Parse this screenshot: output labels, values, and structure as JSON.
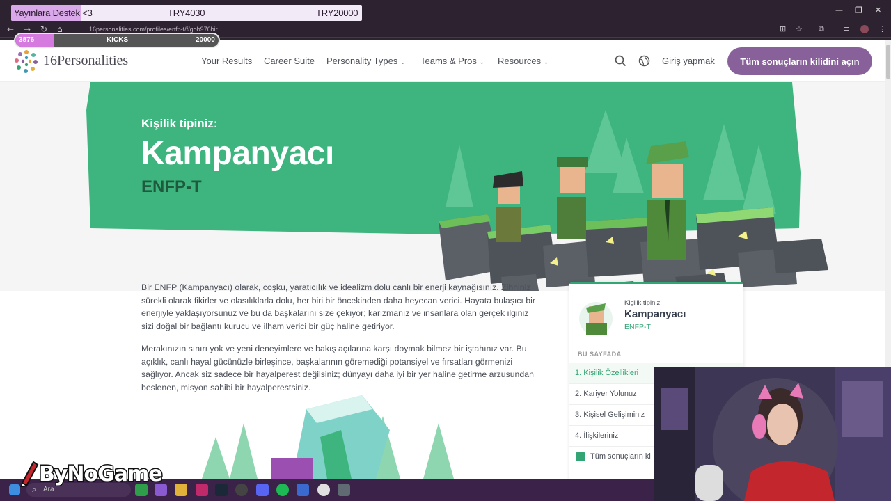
{
  "overlay": {
    "goal_title": "Yayınlara Destek <3",
    "goal_current": "TRY4030",
    "goal_target": "TRY20000",
    "goal_progress": 0.2,
    "kicks_current": "3876",
    "kicks_label": "KICKS",
    "kicks_target": "20000",
    "kicks_progress": 0.19,
    "watermark": "ByNoGame"
  },
  "browser": {
    "url": "16personalities.com/profiles/enfp-t/f/gob976bir"
  },
  "site": {
    "logo_text": "16Personalities",
    "nav": [
      "Your Results",
      "Career Suite",
      "Personality Types",
      "Teams & Pros",
      "Resources"
    ],
    "login": "Giriş yapmak",
    "cta": "Tüm sonuçların kilidini açın"
  },
  "hero": {
    "subtitle": "Kişilik tipiniz:",
    "title": "Kampanyacı",
    "code": "ENFP-T"
  },
  "body": {
    "p1": "Bir ENFP (Kampanyacı) olarak, coşku, yaratıcılık ve idealizm dolu canlı bir enerji kaynağısınız. Zihniniz sürekli olarak fikirler ve olasılıklarla dolu, her biri bir öncekinden daha heyecan verici. Hayata bulaşıcı bir enerjiyle yaklaşıyorsunuz ve bu da başkalarını size çekiyor; karizmanız ve insanlara olan gerçek ilginiz sizi doğal bir bağlantı kurucu ve ilham verici bir güç haline getiriyor.",
    "p2": "Merakınızın sınırı yok ve yeni deneyimlere ve bakış açılarına karşı doymak bilmez bir iştahınız var. Bu açıklık, canlı hayal gücünüzle birleşince, başkalarının göremediği potansiyel ve fırsatları görmenizi sağlıyor. Ancak siz sadece bir hayalperest değilsiniz; dünyayı daha iyi bir yer haline getirme arzusundan beslenen, misyon sahibi bir hayalperestsiniz."
  },
  "sidecard": {
    "subtitle": "Kişilik tipiniz:",
    "name": "Kampanyacı",
    "code": "ENFP-T",
    "section": "BU SAYFADA",
    "toc": [
      "1. Kişilik Özellikleri",
      "2. Kariyer Yolunuz",
      "3. Kişisel Gelişiminiz",
      "4. İlişkileriniz",
      "Tüm sonuçların ki"
    ]
  },
  "taskbar": {
    "search": "Ara"
  },
  "colors": {
    "hero_green": "#3eb57f",
    "accent_purple": "#88619a",
    "accent_green": "#33a474"
  }
}
